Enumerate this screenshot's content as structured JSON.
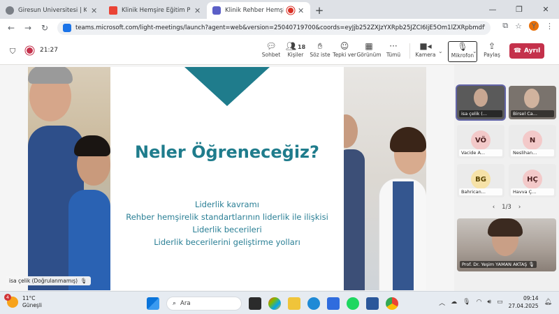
{
  "browser": {
    "tabs": [
      {
        "title": "Giresun Üniversitesi | Kuzeyin Parlayan",
        "color": "#5f6368"
      },
      {
        "title": "Klinik Hemşire Eğitim Programı",
        "color": "#ea4335"
      },
      {
        "title": "Klinik Rehber Hemşire Eğitim",
        "color": "#5b5fc7"
      }
    ],
    "url": "teams.microsoft.com/light-meetings/launch?agent=web&version=25040719700&coords=eyJjb252ZXJzYXRpb25JZCI6IjE5Om1lZXRpbmdfWlRjeU56TTJNe...",
    "profile_initial": "Y"
  },
  "toolbar": {
    "timer": "21:27",
    "buttons": {
      "chat": "Sohbet",
      "people": "Kişiler",
      "people_count": "18",
      "raise": "Söz iste",
      "react": "Tepki ver",
      "view": "Görünüm",
      "more": "Tümü",
      "camera": "Kamera",
      "mic": "Mikrofon",
      "share": "Paylaş"
    },
    "leave": "Ayrıl"
  },
  "slide": {
    "title": "Neler Öğreneceğiz?",
    "bullets": [
      "Liderlik kavramı",
      "Rehber hemşirelik standartlarının liderlik ile ilişkisi",
      "Liderlik becerileri",
      "Liderlik becerilerini geliştirme yolları"
    ],
    "presenter_label": "isa çelik (Doğrulanmamış)"
  },
  "participants": {
    "tiles": [
      {
        "name": "isa çelik (...",
        "initials": "",
        "bg": "#5a5a5a",
        "video": true
      },
      {
        "name": "Birsel Ca...",
        "initials": "",
        "bg": "#6f6a66",
        "video": true
      },
      {
        "name": "Vacide A...",
        "initials": "VÖ",
        "bg": "#f3c9c9"
      },
      {
        "name": "Neslihan...",
        "initials": "N",
        "bg": "#f3c9c9"
      },
      {
        "name": "Bahrican...",
        "initials": "BG",
        "bg": "#f6e2a8"
      },
      {
        "name": "Havva Ç...",
        "initials": "HÇ",
        "bg": "#f3c9c9"
      }
    ],
    "pager": "1/3",
    "featured_name": "Prof. Dr. Yeşim YAMAN AKTAŞ"
  },
  "taskbar": {
    "weather_badge": "4",
    "temperature": "11°C",
    "weather_desc": "Güneşli",
    "search_label": "Ara",
    "time": "09:14",
    "date": "27.04.2025"
  }
}
